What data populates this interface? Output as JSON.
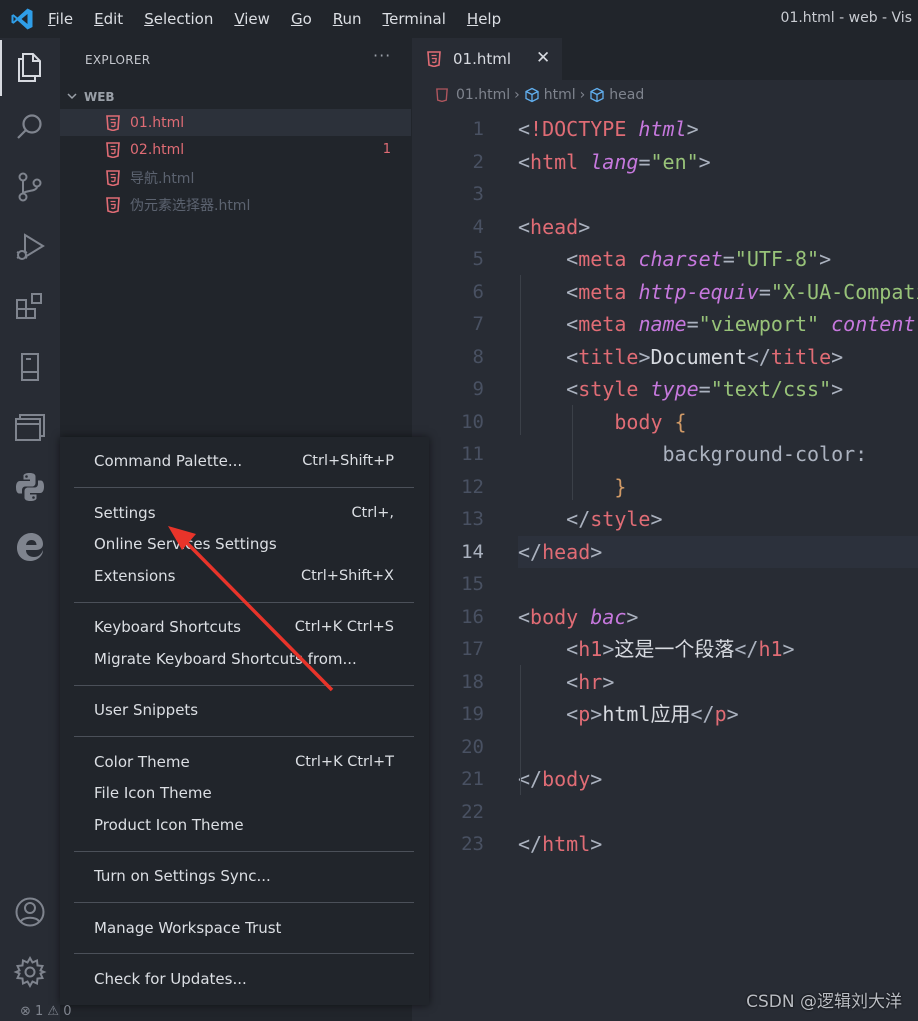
{
  "menubar": {
    "items": [
      "File",
      "Edit",
      "Selection",
      "View",
      "Go",
      "Run",
      "Terminal",
      "Help"
    ]
  },
  "window_title": "01.html - web - Vis",
  "activity_bar": {
    "icons": [
      "files-icon",
      "search-icon",
      "source-control-icon",
      "run-debug-icon",
      "extensions-icon",
      "remote-explorer-icon",
      "panels-icon",
      "python-icon",
      "edge-icon",
      "account-icon",
      "gear-icon"
    ]
  },
  "sidebar": {
    "title": "EXPLORER",
    "more": "···",
    "folder": "WEB",
    "files": [
      {
        "name": "01.html",
        "color": "#e06c75",
        "badge": ""
      },
      {
        "name": "02.html",
        "color": "#e06c75",
        "badge": "1"
      },
      {
        "name": "导航.html",
        "color": "#5c6370",
        "badge": ""
      },
      {
        "name": "伪元素选择器.html",
        "color": "#5c6370",
        "badge": ""
      }
    ]
  },
  "editor": {
    "tab": {
      "label": "01.html",
      "close": "✕"
    },
    "breadcrumb": [
      "01.html",
      "html",
      "head"
    ],
    "line_numbers": [
      "1",
      "2",
      "3",
      "4",
      "5",
      "6",
      "7",
      "8",
      "9",
      "10",
      "11",
      "12",
      "13",
      "14",
      "15",
      "16",
      "17",
      "18",
      "19",
      "20",
      "21",
      "22",
      "23"
    ],
    "current_line": "14"
  },
  "context_menu": {
    "items": [
      {
        "label": "Command Palette...",
        "shortcut": "Ctrl+Shift+P"
      },
      {
        "label": "Settings",
        "shortcut": "Ctrl+,"
      },
      {
        "label": "Online Services Settings",
        "shortcut": ""
      },
      {
        "label": "Extensions",
        "shortcut": "Ctrl+Shift+X"
      },
      {
        "label": "Keyboard Shortcuts",
        "shortcut": "Ctrl+K Ctrl+S"
      },
      {
        "label": "Migrate Keyboard Shortcuts from...",
        "shortcut": ""
      },
      {
        "label": "User Snippets",
        "shortcut": ""
      },
      {
        "label": "Color Theme",
        "shortcut": "Ctrl+K Ctrl+T"
      },
      {
        "label": "File Icon Theme",
        "shortcut": ""
      },
      {
        "label": "Product Icon Theme",
        "shortcut": ""
      },
      {
        "label": "Turn on Settings Sync...",
        "shortcut": ""
      },
      {
        "label": "Manage Workspace Trust",
        "shortcut": ""
      },
      {
        "label": "Check for Updates...",
        "shortcut": ""
      }
    ]
  },
  "statusbar": {
    "problems": "⊗ 1 ⚠ 0"
  },
  "watermark": "CSDN @逻辑刘大洋",
  "colors": {
    "accent_red": "#e06c75",
    "annotation_arrow": "#e8342a"
  }
}
